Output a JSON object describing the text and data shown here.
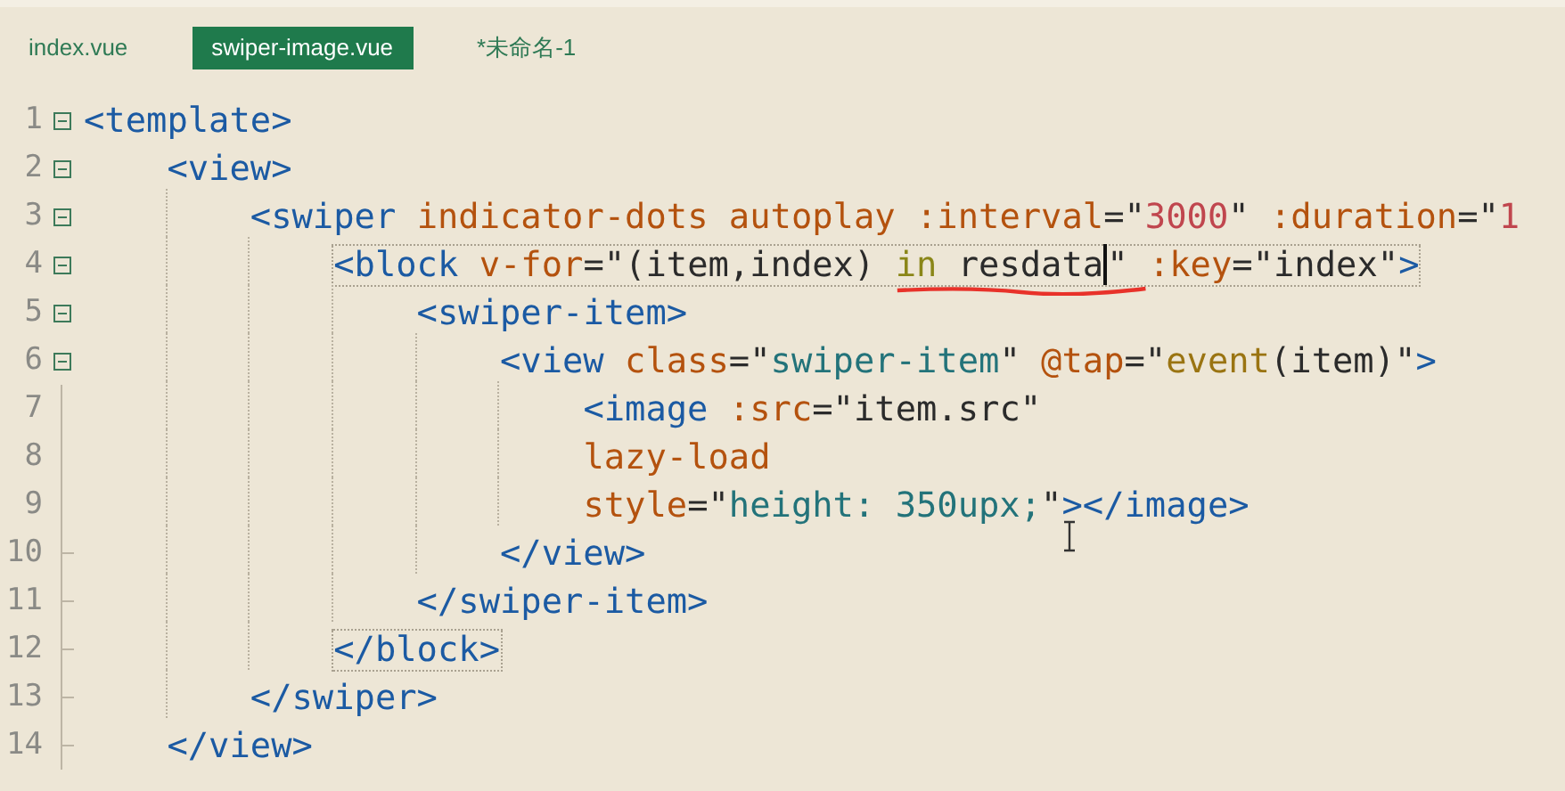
{
  "tabs": [
    {
      "label": "index.vue",
      "selected": false
    },
    {
      "label": "swiper-image.vue",
      "selected": true
    },
    {
      "label": "*未命名-1",
      "selected": false
    }
  ],
  "lines": [
    {
      "number": "1",
      "foldable": true,
      "bracket_match": false,
      "tokens": [
        {
          "kind": "tag",
          "text": "<template>"
        }
      ]
    },
    {
      "number": "2",
      "foldable": true,
      "bracket_match": false,
      "tokens": [
        {
          "kind": "tag",
          "text": "    <view>"
        }
      ]
    },
    {
      "number": "3",
      "foldable": true,
      "bracket_match": false,
      "tokens": [
        {
          "kind": "tag",
          "text": "        <swiper "
        },
        {
          "kind": "attr",
          "text": "indicator-dots autoplay :interval"
        },
        {
          "kind": "plain",
          "text": "=\""
        },
        {
          "kind": "number",
          "text": "3000"
        },
        {
          "kind": "plain",
          "text": "\" "
        },
        {
          "kind": "attr",
          "text": ":duration"
        },
        {
          "kind": "plain",
          "text": "=\""
        },
        {
          "kind": "number",
          "text": "1"
        }
      ]
    },
    {
      "number": "4",
      "foldable": true,
      "bracket_match": true,
      "tokens": [
        {
          "kind": "tag",
          "text": "            <block "
        },
        {
          "kind": "attr",
          "text": "v-for"
        },
        {
          "kind": "plain",
          "text": "=\"(item,index) "
        },
        {
          "kind": "keyword",
          "text": "in",
          "underline": true
        },
        {
          "kind": "plain",
          "text": " resdata",
          "underline": true,
          "cursor": true
        },
        {
          "kind": "plain",
          "text": "\" ",
          "underline": true
        },
        {
          "kind": "attr",
          "text": ":key"
        },
        {
          "kind": "plain",
          "text": "=\"index\""
        },
        {
          "kind": "tag",
          "text": ">"
        }
      ]
    },
    {
      "number": "5",
      "foldable": true,
      "bracket_match": false,
      "tokens": [
        {
          "kind": "tag",
          "text": "                <swiper-item>"
        }
      ]
    },
    {
      "number": "6",
      "foldable": true,
      "bracket_match": false,
      "tokens": [
        {
          "kind": "tag",
          "text": "                    <view "
        },
        {
          "kind": "attr",
          "text": "class"
        },
        {
          "kind": "plain",
          "text": "=\""
        },
        {
          "kind": "css",
          "text": "swiper-item"
        },
        {
          "kind": "plain",
          "text": "\" "
        },
        {
          "kind": "attr",
          "text": "@tap"
        },
        {
          "kind": "plain",
          "text": "=\""
        },
        {
          "kind": "function",
          "text": "event"
        },
        {
          "kind": "plain",
          "text": "(item)\""
        },
        {
          "kind": "tag",
          "text": ">"
        }
      ]
    },
    {
      "number": "7",
      "foldable": false,
      "fold_end": false,
      "bracket_match": false,
      "tokens": [
        {
          "kind": "tag",
          "text": "                        <image "
        },
        {
          "kind": "attr",
          "text": ":src"
        },
        {
          "kind": "plain",
          "text": "=\"item.src\""
        }
      ]
    },
    {
      "number": "8",
      "foldable": false,
      "fold_end": false,
      "bracket_match": false,
      "tokens": [
        {
          "kind": "attr",
          "text": "                        lazy-load"
        }
      ]
    },
    {
      "number": "9",
      "foldable": false,
      "fold_end": false,
      "bracket_match": false,
      "tokens": [
        {
          "kind": "attr",
          "text": "                        style"
        },
        {
          "kind": "plain",
          "text": "=\""
        },
        {
          "kind": "css",
          "text": "height: 350upx;"
        },
        {
          "kind": "plain",
          "text": "\""
        },
        {
          "kind": "tag",
          "text": "></image>"
        }
      ]
    },
    {
      "number": "10",
      "foldable": false,
      "fold_end": true,
      "bracket_match": false,
      "tokens": [
        {
          "kind": "tag",
          "text": "                    </view>"
        }
      ]
    },
    {
      "number": "11",
      "foldable": false,
      "fold_end": true,
      "bracket_match": false,
      "tokens": [
        {
          "kind": "tag",
          "text": "                </swiper-item>"
        }
      ]
    },
    {
      "number": "12",
      "foldable": false,
      "fold_end": true,
      "bracket_match": true,
      "tokens": [
        {
          "kind": "tag",
          "text": "            </block>"
        }
      ]
    },
    {
      "number": "13",
      "foldable": false,
      "fold_end": true,
      "bracket_match": false,
      "tokens": [
        {
          "kind": "tag",
          "text": "        </swiper>"
        }
      ]
    },
    {
      "number": "14",
      "foldable": false,
      "fold_end": true,
      "bracket_match": false,
      "tokens": [
        {
          "kind": "tag",
          "text": "    </view>"
        }
      ]
    }
  ]
}
